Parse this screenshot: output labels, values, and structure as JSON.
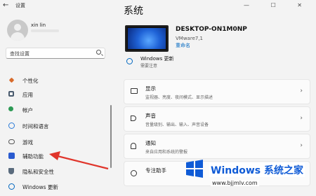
{
  "window": {
    "title": "设置",
    "back_glyph": "←",
    "controls": "— ☐ ✕"
  },
  "user": {
    "name": "xin lin"
  },
  "search": {
    "placeholder": "查找设置"
  },
  "sidebar": {
    "items": [
      {
        "label": "个性化",
        "icon": "brush-icon",
        "color": "#d86b2b"
      },
      {
        "label": "应用",
        "icon": "apps-icon",
        "color": "#4a5b6e"
      },
      {
        "label": "帐户",
        "icon": "account-icon",
        "color": "#2d9a55"
      },
      {
        "label": "时间和语言",
        "icon": "globe-clock-icon",
        "color": "#2b7bd8"
      },
      {
        "label": "游戏",
        "icon": "gamepad-icon",
        "color": "#555555"
      },
      {
        "label": "辅助功能",
        "icon": "accessibility-icon",
        "color": "#2a5bd0"
      },
      {
        "label": "隐私和安全性",
        "icon": "shield-icon",
        "color": "#5a6b7d"
      },
      {
        "label": "Windows 更新",
        "icon": "windows-update-icon",
        "color": "#0067c0"
      }
    ]
  },
  "main": {
    "title": "系统",
    "device": {
      "name": "DESKTOP-ON1M0NP",
      "model": "VMware7,1",
      "rename": "重命名"
    },
    "update": {
      "title": "Windows 更新",
      "status": "需要注意"
    },
    "cards": [
      {
        "title": "显示",
        "desc": "监视器、亮度、夜间模式、显示描述",
        "icon": "monitor-icon"
      },
      {
        "title": "声音",
        "desc": "音量级别、输出、输入、声音设备",
        "icon": "speaker-icon"
      },
      {
        "title": "通知",
        "desc": "来自应用和系统的警报",
        "icon": "bell-icon"
      },
      {
        "title": "专注助手",
        "desc": "",
        "icon": "moon-icon"
      }
    ]
  },
  "watermark": {
    "title": "Windows 系统之家",
    "url": "www.bjjmlv.com"
  },
  "colors": {
    "accent": "#0067c0",
    "arrow": "#e0352b",
    "watermark": "#0f5bd6"
  }
}
